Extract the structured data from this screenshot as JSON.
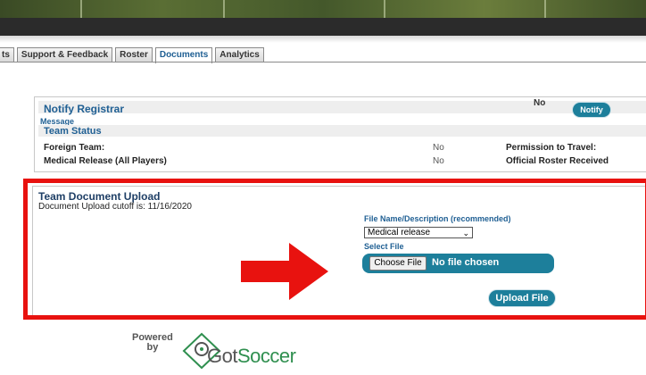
{
  "tabs": [
    "ts",
    "Support & Feedback",
    "Roster",
    "Documents",
    "Analytics"
  ],
  "active_tab": "Documents",
  "notify": {
    "title": "Notify Registrar",
    "value": "No",
    "button": "Notify"
  },
  "message_label": "Message",
  "team_status": {
    "title": "Team Status",
    "rows": [
      {
        "label": "Foreign Team:",
        "value": "No",
        "right_label": "Permission to Travel:"
      },
      {
        "label": "Medical Release (All Players)",
        "value": "No",
        "right_label": "Official Roster Received"
      }
    ]
  },
  "upload": {
    "title": "Team Document Upload",
    "cutoff": "Document Upload cutoff is: 11/16/2020",
    "filename_label": "File Name/Description (recommended)",
    "selected_option": "Medical release",
    "select_file_label": "Select File",
    "choose_button": "Choose File",
    "no_file": "No file chosen",
    "upload_button": "Upload File"
  },
  "footer": {
    "powered": "Powered",
    "by": "by",
    "brand_got": "Got",
    "brand_soccer": "Soccer"
  },
  "colors": {
    "accent": "#1d7f9b",
    "highlight_red": "#e8120f",
    "heading_blue": "#1f5f93"
  }
}
